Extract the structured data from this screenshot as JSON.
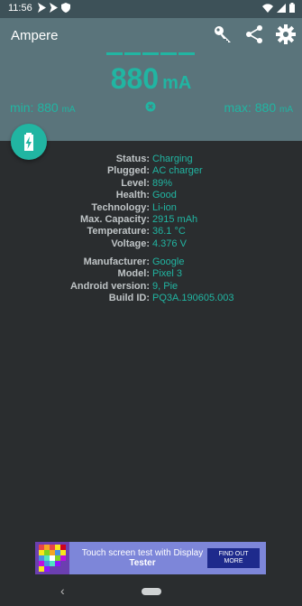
{
  "status_bar": {
    "time": "11:56",
    "left_icons": [
      "send-icon",
      "send-icon",
      "shield-icon"
    ],
    "right_icons": [
      "wifi-icon",
      "signal-icon",
      "battery-icon"
    ]
  },
  "header": {
    "title": "Ampere",
    "icons": [
      "key-icon",
      "share-icon",
      "gear-icon"
    ],
    "current_value": "880",
    "current_unit": "mA",
    "min_label": "min: 880",
    "max_label": "max: 880",
    "minmax_unit": "mA"
  },
  "battery_info": [
    {
      "key": "Status:",
      "value": "Charging"
    },
    {
      "key": "Plugged:",
      "value": "AC charger"
    },
    {
      "key": "Level:",
      "value": "89%"
    },
    {
      "key": "Health:",
      "value": "Good"
    },
    {
      "key": "Technology:",
      "value": "Li-ion"
    },
    {
      "key": "Max. Capacity:",
      "value": "2915 mAh"
    },
    {
      "key": "Temperature:",
      "value": "36.1 °C"
    },
    {
      "key": "Voltage:",
      "value": "4.376 V"
    }
  ],
  "device_info": [
    {
      "key": "Manufacturer:",
      "value": "Google"
    },
    {
      "key": "Model:",
      "value": "Pixel 3"
    },
    {
      "key": "Android version:",
      "value": "9, Pie"
    },
    {
      "key": "Build ID:",
      "value": "PQ3A.190605.003"
    }
  ],
  "ad": {
    "text_line1": "Touch screen test with Display",
    "text_line2": "Tester",
    "cta_line1": "FIND OUT",
    "cta_line2": "MORE"
  },
  "colors": {
    "accent": "#21b5a2",
    "header_bg": "#5a747b",
    "body_bg": "#2a2d2f"
  }
}
